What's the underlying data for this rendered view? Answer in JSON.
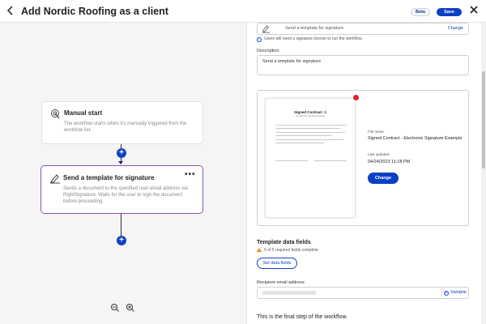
{
  "header": {
    "back_icon": "chevron-left-icon",
    "title": "Add Nordic Roofing as a client",
    "beta_label": "Beta",
    "save_label": "Save",
    "close_icon": "close-icon"
  },
  "canvas": {
    "nodes": [
      {
        "icon": "tap-gesture-icon",
        "title": "Manual start",
        "description": "The workflow starts when it's manually triggered from the workflow list."
      },
      {
        "icon": "pen-signature-icon",
        "title": "Send a template for signature",
        "description": "Sends a document to the specified user email address via RightSignature. Waits for the user to sign the document before proceeding.",
        "menu_label": "•••",
        "selected": true
      }
    ],
    "add_step_label": "+",
    "zoom_out_icon": "zoom-out-icon",
    "zoom_in_icon": "zoom-in-icon"
  },
  "panel": {
    "template_field": {
      "value": "Send a template for signature",
      "change_label": "Change"
    },
    "license_note": "Users will need a signature license to run the workflow.",
    "description_label": "Description",
    "description_value": "Send a template for signature",
    "preview": {
      "doc_title": "Signed Contract -1",
      "doc_subtitle": "An electronic signature example",
      "file_name_label": "File name",
      "file_name": "Signed Contract - Electronic Signature Example",
      "last_updated_label": "Last updated",
      "last_updated": "04/24/2023 11:18 PM",
      "change_label": "Change"
    },
    "template_fields": {
      "title": "Template data fields",
      "status": "0 of 5 required fields complete",
      "button_label": "Set data fields"
    },
    "recipient": {
      "label": "Recipient email address",
      "variable_label": "Variable"
    },
    "final_text": "This is the final step of the workflow."
  },
  "colors": {
    "primary": "#0b3fc4",
    "selected_border": "#8b52b4",
    "warning": "#e98a13",
    "badge": "#d62a2a"
  }
}
